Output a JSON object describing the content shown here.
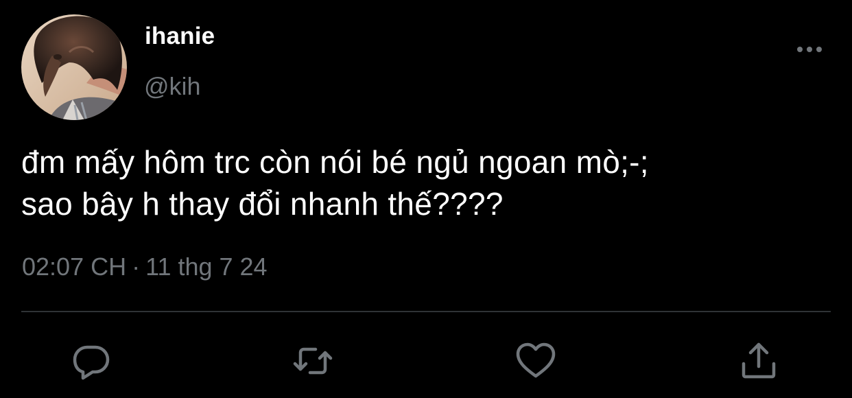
{
  "author": {
    "display_name": "ihanie",
    "handle": "@kih",
    "avatar_icon": "profile-photo-avatar"
  },
  "tweet": {
    "lines": [
      "đm mấy hôm trc còn nói bé ngủ ngoan mò;-;",
      "sao bây h thay đổi nhanh thế????"
    ],
    "time": "02:07 CH",
    "separator": "·",
    "date": "11 thg 7 24"
  },
  "actions": [
    {
      "icon": "reply-icon"
    },
    {
      "icon": "retweet-icon"
    },
    {
      "icon": "like-icon"
    },
    {
      "icon": "share-icon"
    }
  ],
  "colors": {
    "background": "#000000",
    "text_primary": "#ffffff",
    "text_secondary": "#71767b",
    "divider": "#2f3336",
    "icon": "#71767b"
  }
}
